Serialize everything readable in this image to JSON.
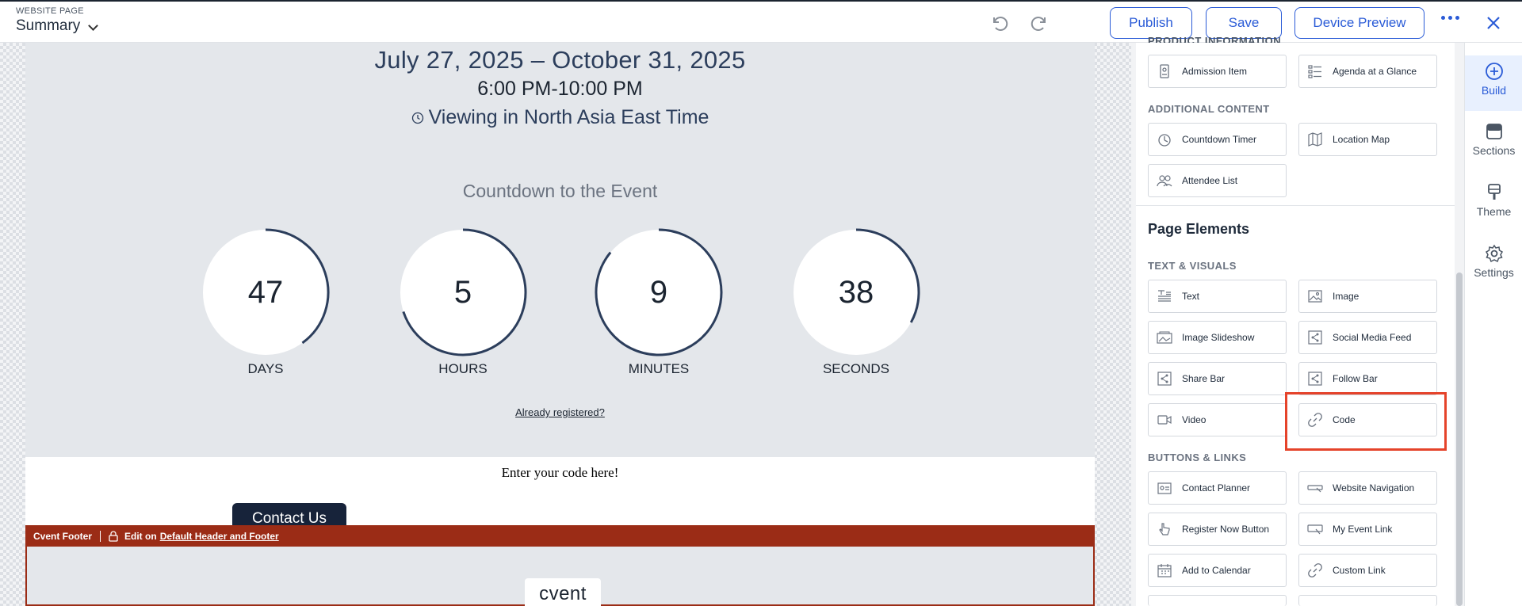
{
  "header": {
    "page_label": "WEBSITE PAGE",
    "page_name": "Summary",
    "publish": "Publish",
    "save": "Save",
    "device_preview": "Device Preview"
  },
  "event": {
    "dates": "July 27, 2025 – October 31, 2025",
    "times": "6:00 PM-10:00 PM",
    "timezone": "Viewing in North Asia East Time",
    "countdown_title": "Countdown to the Event",
    "countdown": [
      {
        "value": "47",
        "label": "DAYS",
        "fraction": 0.4
      },
      {
        "value": "5",
        "label": "HOURS",
        "fraction": 0.7
      },
      {
        "value": "9",
        "label": "MINUTES",
        "fraction": 0.86
      },
      {
        "value": "38",
        "label": "SECONDS",
        "fraction": 0.33
      }
    ],
    "already_registered": "Already registered?",
    "code_placeholder": "Enter your code here!",
    "contact_us": "Contact Us"
  },
  "footer": {
    "name": "Cvent Footer",
    "edit_on": "Edit on",
    "edit_link": "Default Header and Footer",
    "logo": "cvent"
  },
  "panel": {
    "cut_heading": "PRODUCT INFORMATION",
    "product_items": [
      {
        "label": "Admission Item",
        "icon": "admission-icon"
      },
      {
        "label": "Agenda at a Glance",
        "icon": "agenda-icon"
      }
    ],
    "additional_heading": "ADDITIONAL CONTENT",
    "additional_items": [
      {
        "label": "Countdown Timer",
        "icon": "timer-icon"
      },
      {
        "label": "Location Map",
        "icon": "map-icon"
      },
      {
        "label": "Attendee List",
        "icon": "attendees-icon"
      }
    ],
    "page_elements": "Page Elements",
    "text_visuals_heading": "TEXT & VISUALS",
    "text_visuals_items": [
      {
        "label": "Text",
        "icon": "text-icon"
      },
      {
        "label": "Image",
        "icon": "image-icon"
      },
      {
        "label": "Image Slideshow",
        "icon": "slideshow-icon"
      },
      {
        "label": "Social Media Feed",
        "icon": "social-feed-icon"
      },
      {
        "label": "Share Bar",
        "icon": "share-icon"
      },
      {
        "label": "Follow Bar",
        "icon": "follow-icon"
      },
      {
        "label": "Video",
        "icon": "video-icon"
      },
      {
        "label": "Code",
        "icon": "link-icon"
      }
    ],
    "buttons_heading": "BUTTONS & LINKS",
    "buttons_items": [
      {
        "label": "Contact Planner",
        "icon": "contact-icon"
      },
      {
        "label": "Website Navigation",
        "icon": "navigation-icon"
      },
      {
        "label": "Register Now Button",
        "icon": "pointer-icon"
      },
      {
        "label": "My Event Link",
        "icon": "event-link-icon"
      },
      {
        "label": "Add to Calendar",
        "icon": "calendar-icon"
      },
      {
        "label": "Custom Link",
        "icon": "link-icon"
      }
    ]
  },
  "rail": [
    {
      "label": "Build",
      "icon": "plus-circle-icon"
    },
    {
      "label": "Sections",
      "icon": "sections-icon"
    },
    {
      "label": "Theme",
      "icon": "theme-icon"
    },
    {
      "label": "Settings",
      "icon": "gear-icon"
    }
  ],
  "colors": {
    "accent": "#2a5bd7",
    "footer": "#9b2c16",
    "highlight": "#e5432a",
    "ring": "#2c3e5c"
  }
}
